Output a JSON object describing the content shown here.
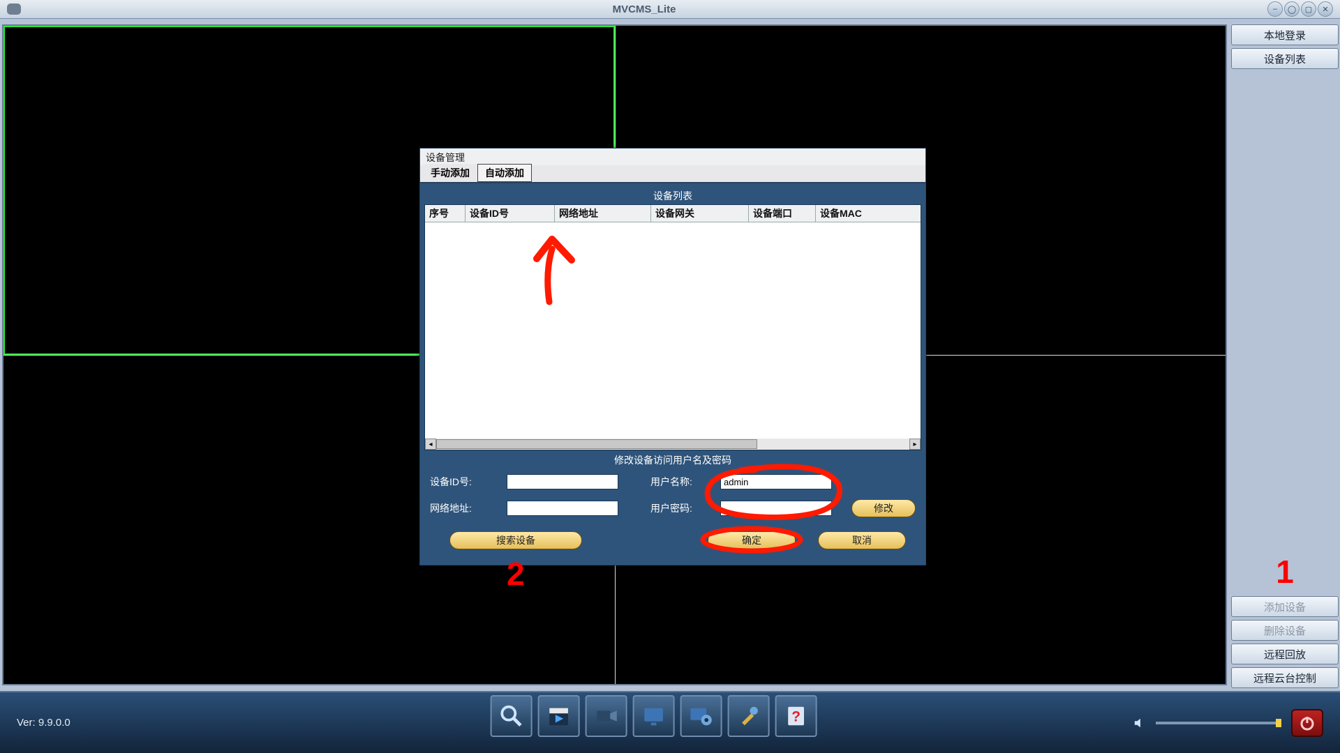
{
  "window": {
    "title": "MVCMS_Lite"
  },
  "sidebar": {
    "local_login": "本地登录",
    "device_list": "设备列表",
    "add_device": "添加设备",
    "delete_device": "删除设备",
    "remote_playback": "远程回放",
    "remote_ptz": "远程云台控制"
  },
  "bottom": {
    "version": "Ver: 9.9.0.0"
  },
  "dialog": {
    "title": "设备管理",
    "tab_manual": "手动添加",
    "tab_auto": "自动添加",
    "list_caption": "设备列表",
    "columns": {
      "c0": "序号",
      "c1": "设备ID号",
      "c2": "网络地址",
      "c3": "设备网关",
      "c4": "设备端口",
      "c5": "设备MAC"
    },
    "edit_caption": "修改设备访问用户名及密码",
    "labels": {
      "device_id": "设备ID号:",
      "net_addr": "网络地址:",
      "username": "用户名称:",
      "password": "用户密码:"
    },
    "values": {
      "device_id": "",
      "net_addr": "",
      "username": "admin",
      "password": ""
    },
    "buttons": {
      "modify": "修改",
      "search": "搜索设备",
      "ok": "确定",
      "cancel": "取消"
    }
  },
  "annotations": {
    "n1": "1",
    "n2": "2"
  },
  "toolbar": {
    "t0": "search-icon",
    "t1": "clapper-icon",
    "t2": "camera-icon",
    "t3": "monitor-icon",
    "t4": "pc-settings-icon",
    "t5": "tools-icon",
    "t6": "help-icon"
  }
}
